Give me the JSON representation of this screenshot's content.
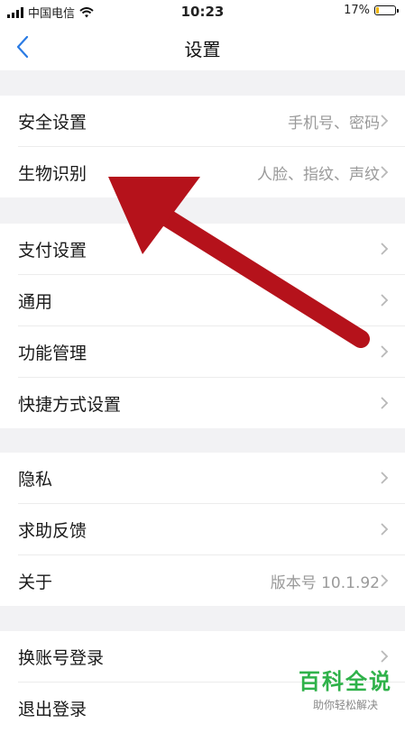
{
  "status_bar": {
    "carrier": "中国电信",
    "time": "10:23",
    "battery": "17%",
    "battery_level": 0.17
  },
  "nav": {
    "title": "设置",
    "back_icon": "chevron-left-icon"
  },
  "groups": [
    {
      "rows": [
        {
          "label": "安全设置",
          "value": "手机号、密码"
        },
        {
          "label": "生物识别",
          "value": "人脸、指纹、声纹"
        }
      ]
    },
    {
      "rows": [
        {
          "label": "支付设置",
          "value": ""
        },
        {
          "label": "通用",
          "value": ""
        },
        {
          "label": "功能管理",
          "value": ""
        },
        {
          "label": "快捷方式设置",
          "value": ""
        }
      ]
    },
    {
      "rows": [
        {
          "label": "隐私",
          "value": ""
        },
        {
          "label": "求助反馈",
          "value": ""
        },
        {
          "label": "关于",
          "value": "版本号 10.1.92"
        }
      ]
    },
    {
      "rows": [
        {
          "label": "换账号登录",
          "value": ""
        },
        {
          "label": "退出登录",
          "value": ""
        }
      ]
    }
  ],
  "watermark": {
    "title": "百科全说",
    "subtitle": "助你轻松解决"
  },
  "colors": {
    "accent": "#2a7be4",
    "annotation_arrow": "#b5121b",
    "watermark": "#2fb24a"
  }
}
